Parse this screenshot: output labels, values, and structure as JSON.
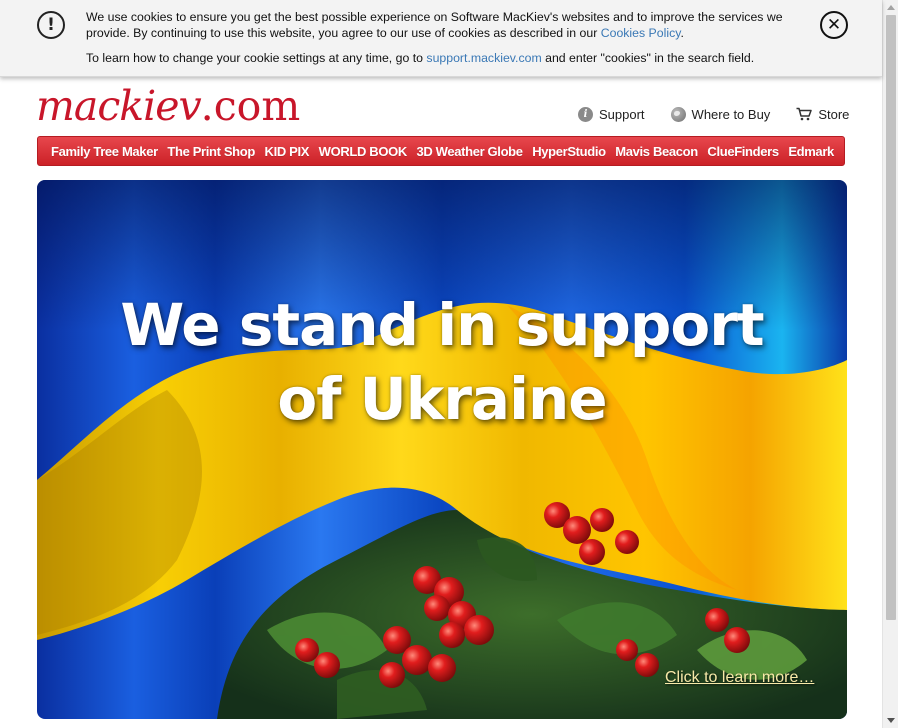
{
  "cookie_banner": {
    "text_line1_prefix": "We use cookies to ensure you get the best possible experience on Software MacKiev's websites and to improve the services we provide. By continuing to use this website, you agree to our use of cookies as described in our ",
    "policy_link": "Cookies Policy",
    "text_line1_suffix": ".",
    "text_line2_prefix": "To learn how to change your cookie settings at any time, go to ",
    "support_link": "support.mackiev.com",
    "text_line2_suffix": " and enter \"cookies\" in the search field.",
    "warning_glyph": "!",
    "close_glyph": "✕"
  },
  "header": {
    "logo_word": "mackiev",
    "logo_suffix": ".com",
    "links": [
      {
        "label": "Support",
        "icon": "info-icon"
      },
      {
        "label": "Where to Buy",
        "icon": "globe-icon"
      },
      {
        "label": "Store",
        "icon": "cart-icon"
      }
    ]
  },
  "nav": {
    "items": [
      "Family Tree Maker",
      "The Print Shop",
      "KID PIX",
      "WORLD BOOK",
      "3D Weather Globe",
      "HyperStudio",
      "Mavis Beacon",
      "ClueFinders",
      "Edmark"
    ]
  },
  "hero": {
    "headline_line1": "We stand in support",
    "headline_line2": "of Ukraine",
    "cta": "Click to learn more…"
  },
  "colors": {
    "brand_red": "#c8162a",
    "link_blue": "#3a78b5",
    "flag_blue": "#0a4fc9",
    "flag_yellow": "#f7c600"
  }
}
